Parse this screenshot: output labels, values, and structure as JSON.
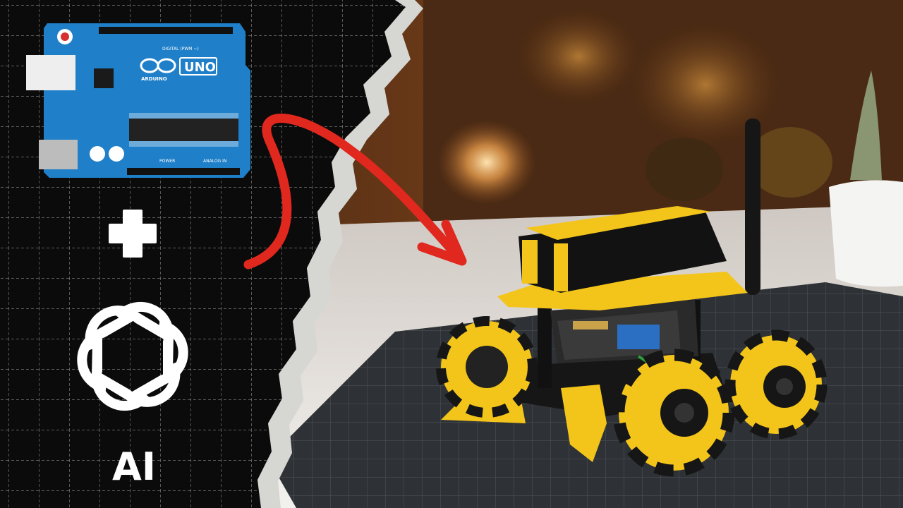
{
  "thumbnail": {
    "board": {
      "model_label": "UNO",
      "brand_label": "ARDUINO",
      "digital_header_label": "DIGITAL (PWM ~)",
      "analog_header_label": "ANALOG IN",
      "power_header_label": "POWER"
    },
    "plus_symbol": "+",
    "ai_logo_caption": "AI"
  },
  "colors": {
    "left_background": "#0b0b0b",
    "grid_lines": "#7a7a7a",
    "board_blue": "#1f7fc8",
    "arrow_red": "#e0281e",
    "robot_yellow": "#f3c51a",
    "robot_black": "#161616",
    "cutting_mat": "#2e3236",
    "desk_white": "#e9e7e4",
    "bokeh_orange": "#8a4a1e"
  },
  "icons": {
    "plus": "plus-icon",
    "ai_logo": "openai-logo-icon",
    "arrow": "curved-arrow-icon"
  }
}
